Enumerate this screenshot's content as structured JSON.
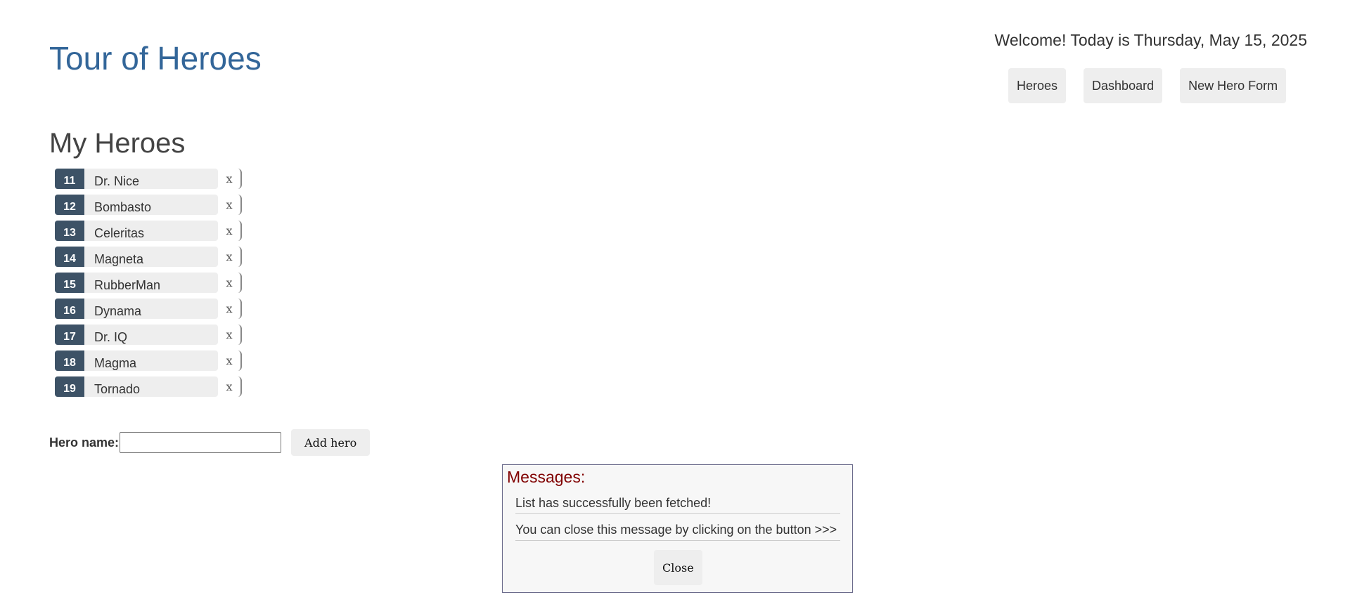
{
  "header": {
    "title": "Tour of Heroes",
    "welcome": "Welcome! Today is Thursday, May 15, 2025"
  },
  "nav": {
    "heroes": "Heroes",
    "dashboard": "Dashboard",
    "new_hero_form": "New Hero Form"
  },
  "main": {
    "title": "My Heroes",
    "delete_label": "x",
    "heroes": [
      {
        "id": "11",
        "name": "Dr. Nice"
      },
      {
        "id": "12",
        "name": "Bombasto"
      },
      {
        "id": "13",
        "name": "Celeritas"
      },
      {
        "id": "14",
        "name": "Magneta"
      },
      {
        "id": "15",
        "name": "RubberMan"
      },
      {
        "id": "16",
        "name": "Dynama"
      },
      {
        "id": "17",
        "name": "Dr. IQ"
      },
      {
        "id": "18",
        "name": "Magma"
      },
      {
        "id": "19",
        "name": "Tornado"
      }
    ]
  },
  "add_form": {
    "label": "Hero name:",
    "value": "",
    "button": "Add hero"
  },
  "messages": {
    "title": "Messages:",
    "items": [
      "List has successfully been fetched!",
      "You can close this message by clicking on the button >>>"
    ],
    "close": "Close"
  },
  "colors": {
    "title": "#336699",
    "badge": "#3d5266",
    "messages_title": "#800000",
    "button_bg": "#eeeeee"
  }
}
